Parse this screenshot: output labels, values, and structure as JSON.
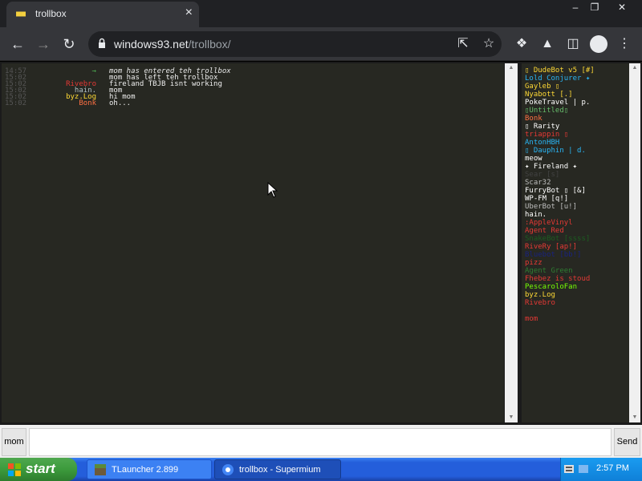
{
  "browser": {
    "tab_title": "trollbox",
    "url_host": "windows93.net",
    "url_path": "/trollbox/",
    "favicon_text": "■■"
  },
  "chat": {
    "messages": [
      {
        "time": "14:57",
        "nick": "→",
        "text": "mom has entered teh trollbox",
        "nick_color": "#4caf50",
        "text_color": "#e8e8e8"
      },
      {
        "time": "15:02",
        "nick": "",
        "text": "mom has left teh trollbox",
        "nick_color": "#f0f0f0",
        "text_color": "#f0f0f0"
      },
      {
        "time": "15:02",
        "nick": "Rivebro",
        "text": "fireland TBJB isnt working",
        "nick_color": "#e53935",
        "text_color": "#f0f0f0"
      },
      {
        "time": "15:02",
        "nick": "hain.",
        "text": "mom",
        "nick_color": "#b0bec5",
        "text_color": "#f0f0f0"
      },
      {
        "time": "15:02",
        "nick": "byz.Log",
        "text": "hi mom",
        "nick_color": "#fdd835",
        "text_color": "#f0f0f0"
      },
      {
        "time": "15:02",
        "nick": "Bonk",
        "text": "oh...",
        "nick_color": "#ff7043",
        "text_color": "#f0f0f0"
      }
    ]
  },
  "users": [
    {
      "name": "▯ DudeBot v5 [#]",
      "color": "#fdd835"
    },
    {
      "name": "Lold Conjurer ✦",
      "color": "#29b6f6"
    },
    {
      "name": "Gayleb ▯",
      "color": "#fdd835"
    },
    {
      "name": "Nyabott [.]",
      "color": "#fdd835"
    },
    {
      "name": "PokeTravel | p.",
      "color": "#ffffff"
    },
    {
      "name": "▯Untitled▯",
      "color": "#66bb6a"
    },
    {
      "name": "Bonk",
      "color": "#ff7043"
    },
    {
      "name": "▯ Rarity",
      "color": "#ffffff"
    },
    {
      "name": "triappin ▯",
      "color": "#e53935"
    },
    {
      "name": "AntonHBH",
      "color": "#29b6f6"
    },
    {
      "name": "▯ Dauphin | d.",
      "color": "#29b6f6"
    },
    {
      "name": "meow",
      "color": "#ffffff"
    },
    {
      "name": "✦ Fireland ✦",
      "color": "#ffffff"
    },
    {
      "name": "Sear [s]",
      "color": "#424242"
    },
    {
      "name": "Scar32",
      "color": "#bdbdbd"
    },
    {
      "name": "FurryBot ▯ [&]",
      "color": "#ffffff"
    },
    {
      "name": "WP-FM [q!]",
      "color": "#ffffff"
    },
    {
      "name": "UberBot [u!]",
      "color": "#bdbdbd"
    },
    {
      "name": "hain.",
      "color": "#ffffff"
    },
    {
      "name": ":AppleVinyl",
      "color": "#e53935"
    },
    {
      "name": "Agent Red",
      "color": "#e53935"
    },
    {
      "name": "SnakeBot [ssss]",
      "color": "#1b5e20"
    },
    {
      "name": "RiveRy [ap!]",
      "color": "#e53935"
    },
    {
      "name": "Bluebot [bb!]",
      "color": "#1a237e"
    },
    {
      "name": "pizz",
      "color": "#e53935"
    },
    {
      "name": "Agent Green",
      "color": "#2e7d32"
    },
    {
      "name": "Fhebez is stoud",
      "color": "#e53935"
    },
    {
      "name": "PescaroloFan",
      "color": "#76ff03"
    },
    {
      "name": "byz.Log",
      "color": "#fdd835"
    },
    {
      "name": "Rivebro",
      "color": "#e53935"
    },
    {
      "name": "",
      "color": "#ffffff"
    },
    {
      "name": "mom",
      "color": "#e53935"
    }
  ],
  "input": {
    "nick_label": "mom",
    "value": "",
    "send_label": "Send"
  },
  "taskbar": {
    "start_label": "start",
    "tasks": [
      {
        "label": "TLauncher 2.899"
      },
      {
        "label": "trollbox - Supermium"
      }
    ],
    "clock": "2:57 PM"
  }
}
